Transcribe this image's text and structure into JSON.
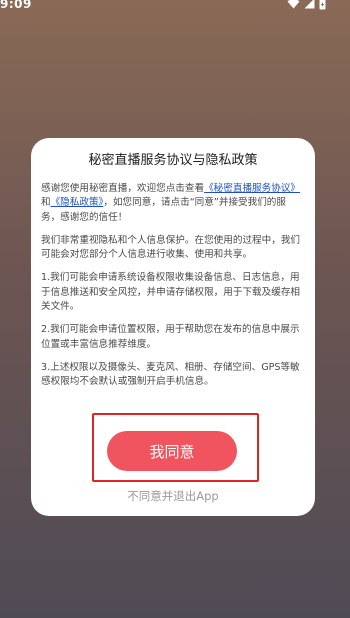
{
  "status_bar": {
    "time": "9:09"
  },
  "dialog": {
    "title": "秘密直播服务协议与隐私政策",
    "p1": {
      "prefix": "感谢您使用秘密直播，欢迎您点击查看",
      "link1": "《秘密直播服务协议》",
      "conj": "和",
      "link2": "《隐私政策》",
      "suffix": "，如您同意，请点击“同意”并接受我们的服务，感谢您的信任！"
    },
    "p2": "我们非常重视隐私和个人信息保护。在您使用的过程中，我们可能会对您部分个人信息进行收集、使用和共享。",
    "p3": "1.我们可能会申请系统设备权限收集设备信息、日志信息，用于信息推送和安全风控，并申请存储权限，用于下载及缓存相关文件。",
    "p4": "2.我们可能会申请位置权限，用于帮助您在发布的信息中展示位置或丰富信息推荐维度。",
    "p5": "3.上述权限以及摄像头、麦克风、相册、存储空间、GPS等敏感权限均不会默认或强制开启手机信息。",
    "agree_label": "我同意",
    "decline_label": "不同意并退出App"
  },
  "colors": {
    "accent": "#f0555f",
    "highlight": "#e02424",
    "link": "#1f4fbf"
  }
}
